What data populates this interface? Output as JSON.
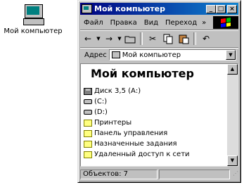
{
  "desktop": {
    "icon_label": "Мой компьютер",
    "icon": "my-computer-icon"
  },
  "window": {
    "title": "Мой компьютер",
    "title_icon": "my-computer-icon",
    "buttons": {
      "minimize": "_",
      "maximize": "□",
      "close": "×"
    }
  },
  "menu": {
    "items": [
      "Файл",
      "Правка",
      "Вид",
      "Переход"
    ],
    "more": "»"
  },
  "toolbar": {
    "back": "←",
    "forward": "→",
    "dropdown": "▼",
    "up": "up-folder-icon",
    "cut": "✂",
    "copy": "copy-icon",
    "paste": "paste-icon",
    "undo": "↶"
  },
  "address": {
    "label": "Адрес",
    "value": "Мой компьютер",
    "dropdown": "▼"
  },
  "content": {
    "heading": "Мой компьютер",
    "items": [
      {
        "label": "Диск 3,5 (А:)",
        "icon": "floppy-drive-icon"
      },
      {
        "label": "(C:)",
        "icon": "hard-drive-icon"
      },
      {
        "label": "(D:)",
        "icon": "hard-drive-icon"
      },
      {
        "label": "Принтеры",
        "icon": "printers-folder-icon"
      },
      {
        "label": "Панель управления",
        "icon": "control-panel-folder-icon"
      },
      {
        "label": "Назначенные задания",
        "icon": "scheduled-tasks-folder-icon"
      },
      {
        "label": "Удаленный доступ к сети",
        "icon": "dial-up-networking-folder-icon"
      }
    ]
  },
  "scrollbar": {
    "up": "▲",
    "down": "▼"
  },
  "status": {
    "text": "Объектов: 7",
    "grip": "⋰"
  },
  "colors": {
    "titlebar_start": "#000080",
    "titlebar_end": "#1084d0",
    "window_face": "#c0c0c0",
    "desktop": "#ffffff"
  }
}
